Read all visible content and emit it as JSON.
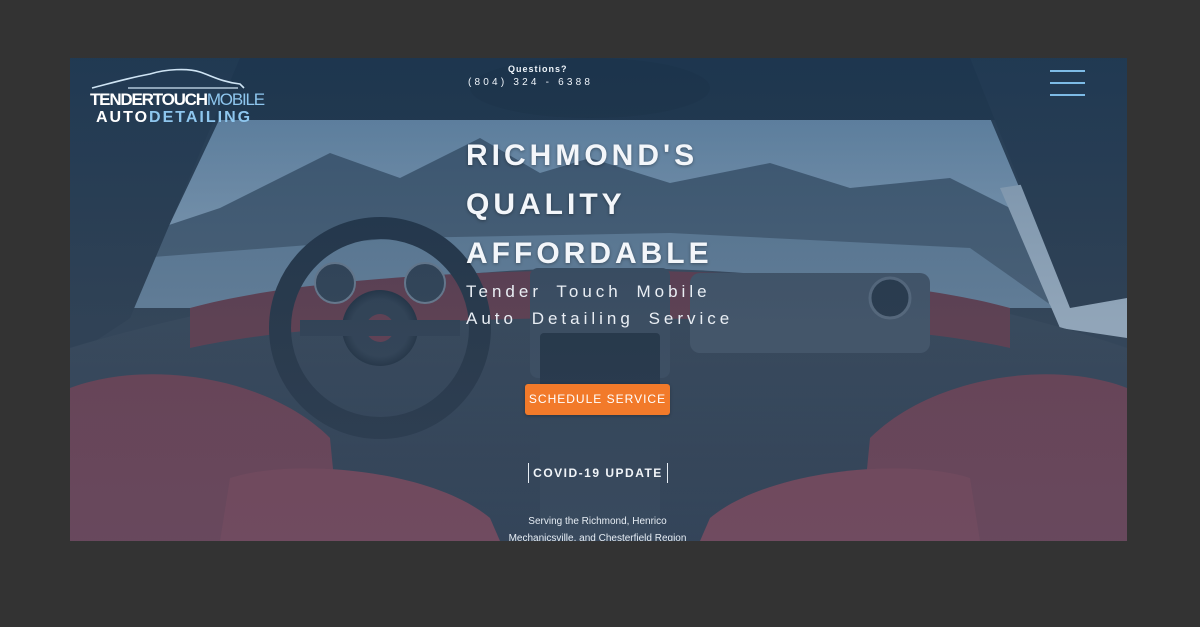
{
  "logo": {
    "word1": "TENDER",
    "word2": "TOUCH",
    "word3": "MOBILE",
    "word4": "AUTO",
    "word5": "DETAILING"
  },
  "header": {
    "questions": "Questions?",
    "phone": "(804) 324 - 6388"
  },
  "hero": {
    "line1": "RICHMOND'S",
    "line2": "QUALITY",
    "line3": "AFFORDABLE",
    "sub1": "Tender Touch Mobile",
    "sub2": "Auto Detailing Service",
    "cta": "SCHEDULE SERVICE",
    "covid": "COVID-19 UPDATE",
    "serving1": "Serving the Richmond, Henrico",
    "serving2": "Mechanicsville, and Chesterfield Region"
  },
  "colors": {
    "accent": "#f27a2a",
    "logo_blue": "#8ec6ee",
    "menu_blue": "#7dbbe6"
  },
  "icons": {
    "menu": "hamburger-menu-icon",
    "logo_car": "car-silhouette-icon"
  }
}
